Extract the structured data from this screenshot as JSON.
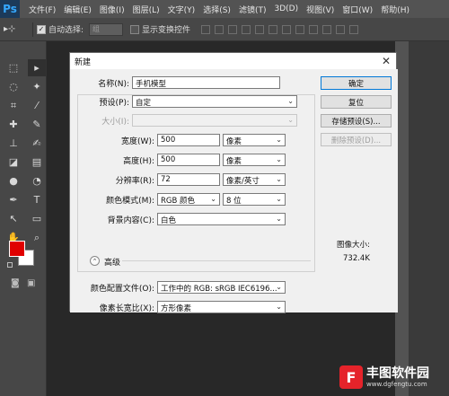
{
  "app": {
    "logo": "Ps"
  },
  "menu": [
    "文件(F)",
    "编辑(E)",
    "图像(I)",
    "图层(L)",
    "文字(Y)",
    "选择(S)",
    "滤镜(T)",
    "3D(D)",
    "视图(V)",
    "窗口(W)",
    "帮助(H)"
  ],
  "options": {
    "tool_icon": "move-tool",
    "auto_select_label": "自动选择:",
    "auto_select_value": "组",
    "show_transform_label": "显示变换控件"
  },
  "toolbox": {
    "tools": [
      "marquee-tool",
      "move-tool",
      "lasso-tool",
      "magic-wand-tool",
      "crop-tool",
      "eyedropper-tool",
      "healing-brush-tool",
      "brush-tool",
      "clone-stamp-tool",
      "history-brush-tool",
      "eraser-tool",
      "gradient-tool",
      "blur-tool",
      "dodge-tool",
      "pen-tool",
      "type-tool",
      "path-selection-tool",
      "rectangle-tool",
      "hand-tool",
      "zoom-tool"
    ],
    "foreground_color": "#e00000",
    "background_color": "#ffffff"
  },
  "dialog": {
    "title": "新建",
    "name_label": "名称(N):",
    "name_value": "手机模型",
    "preset_label": "预设(P):",
    "preset_value": "自定",
    "size_label": "大小(I):",
    "width_label": "宽度(W):",
    "width_value": "500",
    "width_unit": "像素",
    "height_label": "高度(H):",
    "height_value": "500",
    "height_unit": "像素",
    "resolution_label": "分辨率(R):",
    "resolution_value": "72",
    "resolution_unit": "像素/英寸",
    "color_mode_label": "颜色模式(M):",
    "color_mode_value": "RGB 颜色",
    "bit_depth_value": "8 位",
    "bg_contents_label": "背景内容(C):",
    "bg_contents_value": "白色",
    "advanced_label": "高级",
    "color_profile_label": "颜色配置文件(O):",
    "color_profile_value": "工作中的 RGB: sRGB IEC6196...",
    "pixel_aspect_label": "像素长宽比(X):",
    "pixel_aspect_value": "方形像素",
    "ok_button": "确定",
    "reset_button": "复位",
    "save_preset_button": "存储预设(S)...",
    "delete_preset_button": "删除预设(D)...",
    "image_size_label": "图像大小:",
    "image_size_value": "732.4K"
  },
  "watermark": {
    "title": "丰图软件园",
    "url": "www.dgfengtu.com"
  }
}
